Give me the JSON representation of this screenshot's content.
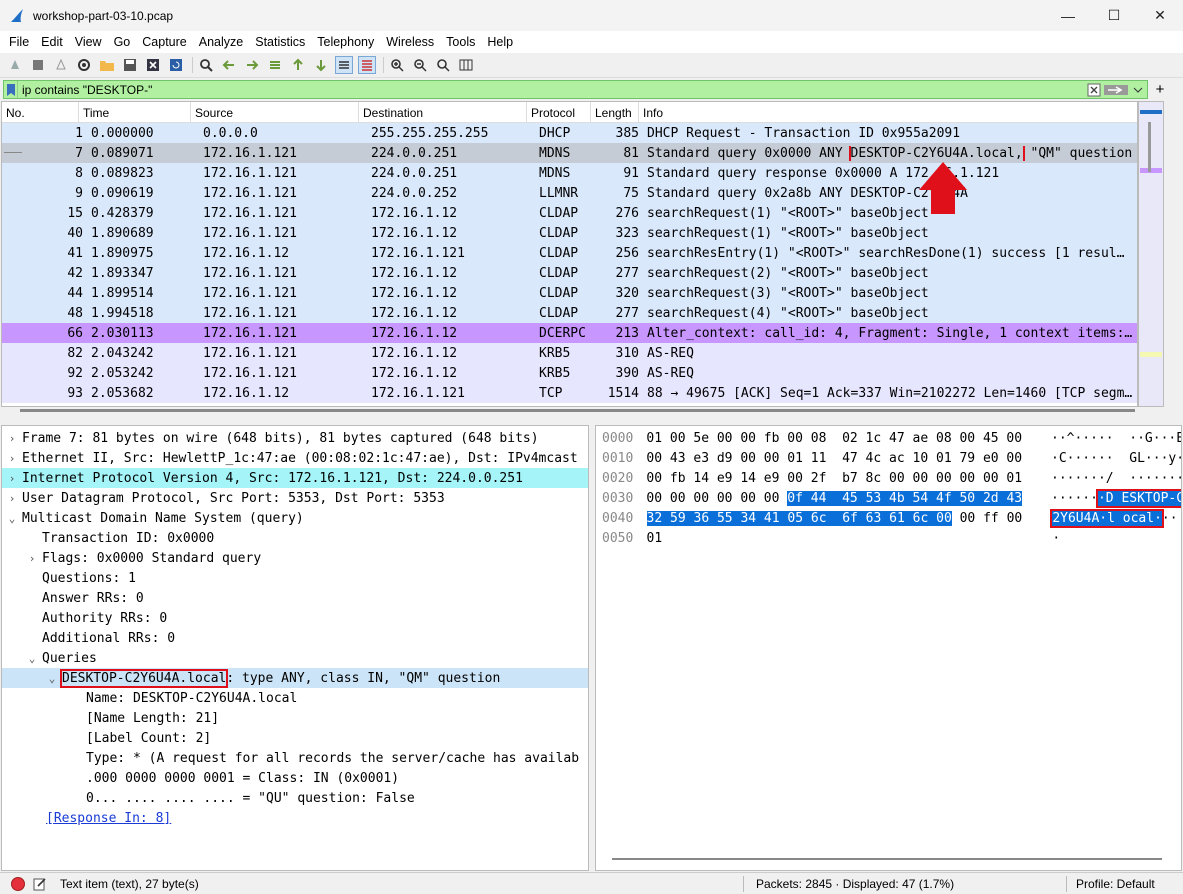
{
  "window": {
    "title": "workshop-part-03-10.pcap",
    "minimize": "—",
    "maximize": "☐",
    "close": "✕"
  },
  "menu": [
    "File",
    "Edit",
    "View",
    "Go",
    "Capture",
    "Analyze",
    "Statistics",
    "Telephony",
    "Wireless",
    "Tools",
    "Help"
  ],
  "filter": {
    "value": "ip contains \"DESKTOP-\""
  },
  "packet_list": {
    "headers": [
      "No.",
      "Time",
      "Source",
      "Destination",
      "Protocol",
      "Length",
      "Info"
    ],
    "rows": [
      {
        "no": "1",
        "time": "0.000000",
        "src": "0.0.0.0",
        "dst": "255.255.255.255",
        "proto": "DHCP",
        "len": "385",
        "info": "DHCP Request  - Transaction ID 0x955a2091",
        "style": "blue"
      },
      {
        "no": "7",
        "time": "0.089071",
        "src": "172.16.1.121",
        "dst": "224.0.0.251",
        "proto": "MDNS",
        "len": "81",
        "info_pre": "Standard query 0x0000 ANY ",
        "info_hl": "DESKTOP-C2Y6U4A.local,",
        "info_post": " \"QM\" question",
        "style": "sel"
      },
      {
        "no": "8",
        "time": "0.089823",
        "src": "172.16.1.121",
        "dst": "224.0.0.251",
        "proto": "MDNS",
        "len": "91",
        "info": "Standard query response 0x0000 A 172.16.1.121",
        "style": "blue"
      },
      {
        "no": "9",
        "time": "0.090619",
        "src": "172.16.1.121",
        "dst": "224.0.0.252",
        "proto": "LLMNR",
        "len": "75",
        "info": "Standard query 0x2a8b ANY DESKTOP-C2Y6U4A",
        "style": "blue"
      },
      {
        "no": "15",
        "time": "0.428379",
        "src": "172.16.1.121",
        "dst": "172.16.1.12",
        "proto": "CLDAP",
        "len": "276",
        "info": "searchRequest(1) \"<ROOT>\" baseObject",
        "style": "blue"
      },
      {
        "no": "40",
        "time": "1.890689",
        "src": "172.16.1.121",
        "dst": "172.16.1.12",
        "proto": "CLDAP",
        "len": "323",
        "info": "searchRequest(1) \"<ROOT>\" baseObject",
        "style": "blue"
      },
      {
        "no": "41",
        "time": "1.890975",
        "src": "172.16.1.12",
        "dst": "172.16.1.121",
        "proto": "CLDAP",
        "len": "256",
        "info": "searchResEntry(1) \"<ROOT>\" searchResDone(1) success  [1 resul…",
        "style": "blue"
      },
      {
        "no": "42",
        "time": "1.893347",
        "src": "172.16.1.121",
        "dst": "172.16.1.12",
        "proto": "CLDAP",
        "len": "277",
        "info": "searchRequest(2) \"<ROOT>\" baseObject",
        "style": "blue"
      },
      {
        "no": "44",
        "time": "1.899514",
        "src": "172.16.1.121",
        "dst": "172.16.1.12",
        "proto": "CLDAP",
        "len": "320",
        "info": "searchRequest(3) \"<ROOT>\" baseObject",
        "style": "blue"
      },
      {
        "no": "48",
        "time": "1.994518",
        "src": "172.16.1.121",
        "dst": "172.16.1.12",
        "proto": "CLDAP",
        "len": "277",
        "info": "searchRequest(4) \"<ROOT>\" baseObject",
        "style": "blue"
      },
      {
        "no": "66",
        "time": "2.030113",
        "src": "172.16.1.121",
        "dst": "172.16.1.12",
        "proto": "DCERPC",
        "len": "213",
        "info": "Alter_context: call_id: 4, Fragment: Single, 1 context items:…",
        "style": "purple"
      },
      {
        "no": "82",
        "time": "2.043242",
        "src": "172.16.1.121",
        "dst": "172.16.1.12",
        "proto": "KRB5",
        "len": "310",
        "info": "AS-REQ",
        "style": "lav"
      },
      {
        "no": "92",
        "time": "2.053242",
        "src": "172.16.1.121",
        "dst": "172.16.1.12",
        "proto": "KRB5",
        "len": "390",
        "info": "AS-REQ",
        "style": "lav"
      },
      {
        "no": "93",
        "time": "2.053682",
        "src": "172.16.1.12",
        "dst": "172.16.1.121",
        "proto": "TCP",
        "len": "1514",
        "info": "88 → 49675 [ACK] Seq=1 Ack=337 Win=2102272 Len=1460 [TCP segm…",
        "style": "lav"
      }
    ]
  },
  "detail": {
    "frame": "Frame 7: 81 bytes on wire (648 bits), 81 bytes captured (648 bits)",
    "ethernet": "Ethernet II, Src: HewlettP_1c:47:ae (00:08:02:1c:47:ae), Dst: IPv4mcast",
    "ip": "Internet Protocol Version 4, Src: 172.16.1.121, Dst: 224.0.0.251",
    "udp": "User Datagram Protocol, Src Port: 5353, Dst Port: 5353",
    "mdns": "Multicast Domain Name System (query)",
    "txid": "Transaction ID: 0x0000",
    "flags": "Flags: 0x0000 Standard query",
    "questions": "Questions: 1",
    "answer_rrs": "Answer RRs: 0",
    "authority_rrs": "Authority RRs: 0",
    "additional_rrs": "Additional RRs: 0",
    "queries": "Queries",
    "query_name_hl": "DESKTOP-C2Y6U4A.local",
    "query_rest": ": type ANY, class IN, \"QM\" question",
    "name": "Name: DESKTOP-C2Y6U4A.local",
    "name_len": "[Name Length: 21]",
    "label_count": "[Label Count: 2]",
    "type": "Type: * (A request for all records the server/cache has availab",
    "class": ".000 0000 0000 0001 = Class: IN (0x0001)",
    "qu": "0... .... .... .... = \"QU\" question: False",
    "response_in": "[Response In: 8]"
  },
  "hex": {
    "rows": [
      {
        "off": "0000",
        "b1": "01 00 5e 00 00 fb 00 08  02 1c 47 ae 08 00 45 00",
        "a1": "··^·····  ··G···E·"
      },
      {
        "off": "0010",
        "b1": "00 43 e3 d9 00 00 01 11  47 4c ac 10 01 79 e0 00",
        "a1": "·C······  GL···y··"
      },
      {
        "off": "0020",
        "b1": "00 fb 14 e9 14 e9 00 2f  b7 8c 00 00 00 00 00 01",
        "a1": "·······/  ········"
      },
      {
        "off": "0030",
        "b1": "00 00 00 00 00 00 ",
        "b2": "0f 44  45 53 4b 54 4f 50 2d 43",
        "a1": "······",
        "a2": "·D ESKTOP-C"
      },
      {
        "off": "0040",
        "b2": "32 59 36 55 34 41 05 6c  6f 63 61 6c 00",
        "b3": " 00 ff 00",
        "a2": "2Y6U4A·l ocal·",
        "a3": "··"
      },
      {
        "off": "0050",
        "b1": "01",
        "a1": "·"
      }
    ]
  },
  "status": {
    "item": "Text item (text), 27 byte(s)",
    "packets": "Packets: 2845 · Displayed: 47 (1.7%)",
    "profile": "Profile: Default"
  },
  "colors": {
    "filter_ok": "#b0f0a0",
    "dcerpc": "#c797ff",
    "highlight": "#0a6fd8",
    "annotation": "#e0101a"
  }
}
